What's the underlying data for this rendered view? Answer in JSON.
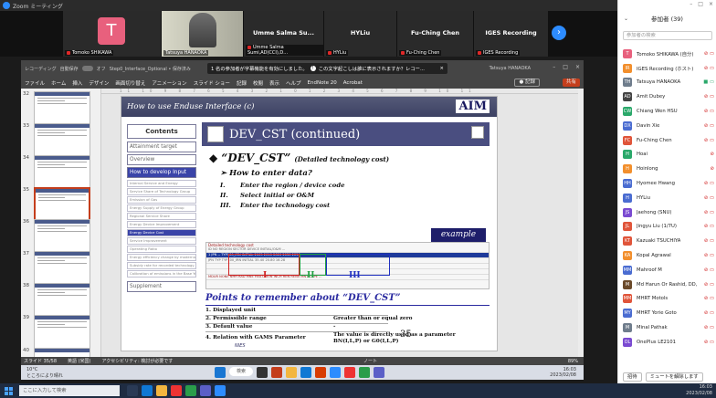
{
  "zoom": {
    "window_title": "Zoom ミーティング",
    "tiles": [
      {
        "name": "Tomoko SHIKAWA",
        "type": "avatar",
        "avatar_letter": "T"
      },
      {
        "name": "Tatsuya HANAOKA",
        "type": "camera"
      },
      {
        "name": "Umme Salma Sumi,AD(CCI),D...",
        "display": "Umme Salma Su...",
        "type": "name"
      },
      {
        "name": "HYLiu",
        "display": "HYLiu",
        "type": "name"
      },
      {
        "name": "Fu-Ching Chen",
        "display": "Fu-Ching Chen",
        "type": "name"
      },
      {
        "name": "IGES Recording",
        "display": "IGES Recording",
        "type": "name"
      }
    ],
    "next_page_icon": "chevron-right-icon"
  },
  "powerpoint": {
    "title_left": "レコーディング",
    "autosave_label": "自動保存",
    "autosave_state": "オフ",
    "filename": "Step0_Interface_Optional • 保存済み",
    "share_notice": "1 名の参加者が字幕機能を有効にしました。",
    "share_notice_2": "この文字起こしは誰に表示されますか？レコー...",
    "share_close": "×",
    "presenter_name": "Tatsuya HANAOKA",
    "menu": [
      "ファイル",
      "ホーム",
      "挿入",
      "デザイン",
      "画面切り替え",
      "アニメーション",
      "スライド ショー",
      "記録",
      "校閲",
      "表示",
      "ヘルプ",
      "EndNote 20",
      "Acrobat"
    ],
    "record_label": "● 記録",
    "share_label": "共有",
    "ruler": "11 10 9 8 7 6 5 4 3 2 1 0 1 2 3 4 5 6 7 8 9 10 11",
    "thumb_numbers": [
      "32",
      "33",
      "34",
      "35",
      "36",
      "37",
      "38",
      "39",
      "40"
    ],
    "status_left": "スライド 35/58",
    "status_lang": "英語 (米国)",
    "status_access": "アクセシビリティ: 検討が必要です",
    "status_notes": "ノート",
    "status_zoom": "89%"
  },
  "slide": {
    "header": "How to use Enduse Interface (c)",
    "logo": "AIM",
    "sidebar_heading": "Contents",
    "sidebar_items": [
      {
        "label": "Attainment target",
        "active": false
      },
      {
        "label": "Overview",
        "active": false
      },
      {
        "label": "How to develop Input",
        "active": true
      }
    ],
    "sidebar_subitems": [
      {
        "label": "Internal Service and Energy",
        "active": false
      },
      {
        "label": "Service Share of Technology Group",
        "active": false
      },
      {
        "label": "Emission of Gas",
        "active": false
      },
      {
        "label": "Energy Supply of Energy Group",
        "active": false
      },
      {
        "label": "Regional Service Share",
        "active": false
      },
      {
        "label": "Energy Device Improvement",
        "active": false
      },
      {
        "label": "Energy Device Cost",
        "active": true
      },
      {
        "label": "Service Improvement",
        "active": false
      },
      {
        "label": "Operating Ratio",
        "active": false
      },
      {
        "label": "Energy efficiency change by modernization",
        "active": false
      },
      {
        "label": "Subsidy rate for recorded technology",
        "active": false
      },
      {
        "label": "Calibration of emissions in the Base Year",
        "active": false
      }
    ],
    "supplement": "Supplement",
    "title": "DEV_CST (continued)",
    "main_bullet": "“DEV_CST”",
    "main_bullet_suffix": "(Detailed technology cost)",
    "sub_bullet": "How to enter data?",
    "steps": [
      {
        "num": "I.",
        "text": "Enter the region / device code"
      },
      {
        "num": "II.",
        "text": "Select initial or O&M"
      },
      {
        "num": "III.",
        "text": "Enter the technology cost"
      }
    ],
    "example_label": "example",
    "table_title": "Detailed technology cost",
    "table_headers": "ID   NO   REGION   SECTOR   DEVICE   INITIAL/O&M   ...",
    "table_row_1": "1   JPN   --   TYP100_IRN   INITIAL   2005   2010   2020   2030   2050",
    "table_row_2": "JPN   TYP   TYP100_IRN   INITIAL   35.40   20.80   16.28",
    "table_row_3": "MDUR  NONE  NHH  RAD  MNE  HEAT  IRON  INCH  REN  RENV  MNT  CAPE ...",
    "roman_labels": [
      "I",
      "II",
      "III"
    ],
    "points_title": "Points to remember about “DEV_CST”",
    "points": [
      {
        "left": "1. Displayed unit",
        "right": ""
      },
      {
        "left": "2. Permissible range",
        "right": "Greater than or equal zero"
      },
      {
        "left": "3. Default value",
        "right": "-"
      },
      {
        "left": "4. Relation with GAMS Parameter",
        "right": "The value is directly used as a parameter BN(I,L,P) or G0(I,L,P)"
      }
    ],
    "nies_label": "NIES",
    "page_number": "35"
  },
  "remote_taskbar": {
    "temp": "10°C",
    "weather": "ところにより晴れ",
    "search": "検索",
    "time": "16:03",
    "date": "2023/02/08"
  },
  "participants": {
    "title": "参加者 (39)",
    "search_placeholder": "参加者の検索",
    "list": [
      {
        "name": "Tomoko SHIKAWA (自分)",
        "initial": "T",
        "color": "#e8607d"
      },
      {
        "name": "IGES Recording (ホスト)",
        "initial": "IR",
        "color": "#f28f2d"
      },
      {
        "name": "Tatsuya HANAOKA",
        "initial": "TH",
        "color": "#6f7d8c"
      },
      {
        "name": "Amit Dubey",
        "initial": "AD",
        "color": "#444"
      },
      {
        "name": "Chiang Wen HSU",
        "initial": "CW",
        "color": "#2aa86a"
      },
      {
        "name": "Davin Xie",
        "initial": "DX",
        "color": "#4a6cd1"
      },
      {
        "name": "Fu-Ching Chen",
        "initial": "FC",
        "color": "#e0553a"
      },
      {
        "name": "Hoai",
        "initial": "H",
        "color": "#2aa86a"
      },
      {
        "name": "Hoinlong",
        "initial": "H",
        "color": "#f28f2d"
      },
      {
        "name": "Hyomee Hwang",
        "initial": "HH",
        "color": "#4a6cd1"
      },
      {
        "name": "HYLiu",
        "initial": "H",
        "color": "#4a6cd1"
      },
      {
        "name": "Jaehong (SNU)",
        "initial": "JS",
        "color": "#7a4ad1"
      },
      {
        "name": "Jingyu Liu (1/7U)",
        "initial": "JL",
        "color": "#e0553a"
      },
      {
        "name": "Kazuaki TSUCHIYA",
        "initial": "KT",
        "color": "#e0553a"
      },
      {
        "name": "Kopal Agrawal",
        "initial": "KA",
        "color": "#f28f2d"
      },
      {
        "name": "Mahroof M",
        "initial": "MM",
        "color": "#4a6cd1"
      },
      {
        "name": "Md Harun Or Rashid, DD, Dol...",
        "initial": "M",
        "color": "#6b4a2a"
      },
      {
        "name": "MHRT Motols",
        "initial": "MM",
        "color": "#e0553a"
      },
      {
        "name": "MHRT Yorie Goto",
        "initial": "MY",
        "color": "#4a6cd1"
      },
      {
        "name": "Minal Pathak",
        "initial": "M",
        "color": "#6f7d8c"
      },
      {
        "name": "OnePlus LE2101",
        "initial": "OL",
        "color": "#7a4ad1"
      }
    ],
    "invite_label": "招待",
    "unmute_label": "ミュートを解除します"
  },
  "windows": {
    "search_placeholder": "ここに入力して検索",
    "time": "16:03",
    "date": "2023/02/08"
  }
}
